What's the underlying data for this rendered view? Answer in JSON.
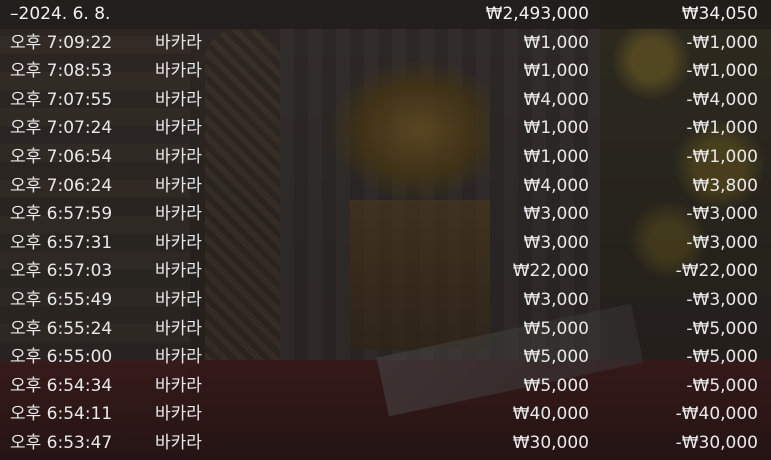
{
  "header": {
    "date": "–2024. 6. 8.",
    "total_bet": "₩2,493,000",
    "total_result": "₩34,050"
  },
  "rows": [
    {
      "time": "오후 7:09:22",
      "game": "바카라",
      "bet": "₩1,000",
      "result": "-₩1,000"
    },
    {
      "time": "오후 7:08:53",
      "game": "바카라",
      "bet": "₩1,000",
      "result": "-₩1,000"
    },
    {
      "time": "오후 7:07:55",
      "game": "바카라",
      "bet": "₩4,000",
      "result": "-₩4,000"
    },
    {
      "time": "오후 7:07:24",
      "game": "바카라",
      "bet": "₩1,000",
      "result": "-₩1,000"
    },
    {
      "time": "오후 7:06:54",
      "game": "바카라",
      "bet": "₩1,000",
      "result": "-₩1,000"
    },
    {
      "time": "오후 7:06:24",
      "game": "바카라",
      "bet": "₩4,000",
      "result": "₩3,800"
    },
    {
      "time": "오후 6:57:59",
      "game": "바카라",
      "bet": "₩3,000",
      "result": "-₩3,000"
    },
    {
      "time": "오후 6:57:31",
      "game": "바카라",
      "bet": "₩3,000",
      "result": "-₩3,000"
    },
    {
      "time": "오후 6:57:03",
      "game": "바카라",
      "bet": "₩22,000",
      "result": "-₩22,000"
    },
    {
      "time": "오후 6:55:49",
      "game": "바카라",
      "bet": "₩3,000",
      "result": "-₩3,000"
    },
    {
      "time": "오후 6:55:24",
      "game": "바카라",
      "bet": "₩5,000",
      "result": "-₩5,000"
    },
    {
      "time": "오후 6:55:00",
      "game": "바카라",
      "bet": "₩5,000",
      "result": "-₩5,000"
    },
    {
      "time": "오후 6:54:34",
      "game": "바카라",
      "bet": "₩5,000",
      "result": "-₩5,000"
    },
    {
      "time": "오후 6:54:11",
      "game": "바카라",
      "bet": "₩40,000",
      "result": "-₩40,000"
    },
    {
      "time": "오후 6:53:47",
      "game": "바카라",
      "bet": "₩30,000",
      "result": "-₩30,000"
    }
  ]
}
